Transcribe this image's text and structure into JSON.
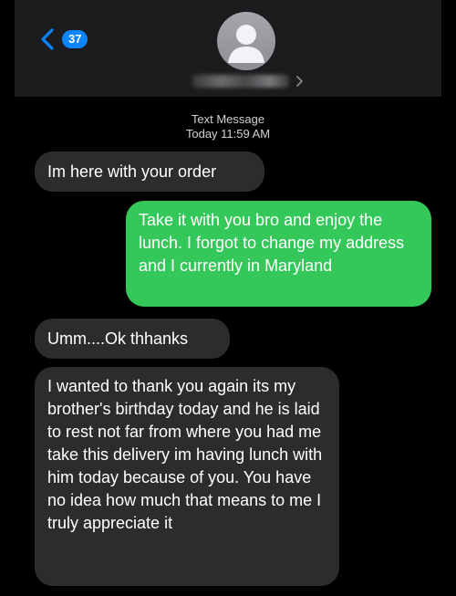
{
  "header": {
    "unread_count": "37",
    "contact_name_redacted": true
  },
  "thread": {
    "service_label": "Text Message",
    "timestamp": "Today 11:59 AM"
  },
  "messages": [
    {
      "direction": "incoming",
      "text": "Im here with your order"
    },
    {
      "direction": "outgoing",
      "text": "Take it with you bro and enjoy the lunch. I forgot to change my address and I currently in Maryland"
    },
    {
      "direction": "incoming",
      "text": "Umm....Ok thhanks"
    },
    {
      "direction": "incoming",
      "text": "I wanted to thank you again its my brother's birthday today and he is laid to rest not far from where you had me take this delivery im having lunch with him today because of you. You have no idea how much that means to me I truly appreciate it"
    }
  ],
  "colors": {
    "incoming_bubble": "#2c2c2e",
    "outgoing_bubble": "#34c759",
    "accent": "#0a84ff"
  },
  "icons": [
    "chevron-left-icon",
    "contact-avatar-icon",
    "chevron-right-icon"
  ]
}
